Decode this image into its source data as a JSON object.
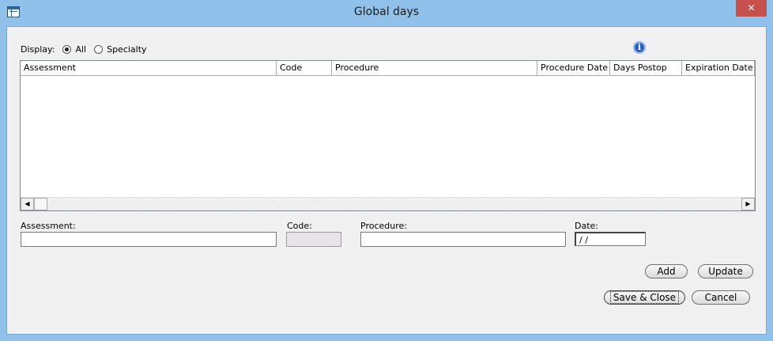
{
  "window": {
    "title": "Global days",
    "close_glyph": "✕"
  },
  "icons": {
    "app": "table-icon",
    "info": "info-icon",
    "info_glyph": "i",
    "scroll_left": "◀",
    "scroll_right": "▶"
  },
  "display": {
    "label": "Display:",
    "options": [
      {
        "label": "All",
        "selected": true
      },
      {
        "label": "Specialty",
        "selected": false
      }
    ]
  },
  "grid": {
    "columns": [
      "Assessment",
      "Code",
      "Procedure",
      "Procedure Date",
      "Days Postop",
      "Expiration Date"
    ],
    "rows": []
  },
  "form": {
    "assessment_label": "Assessment:",
    "assessment_value": "",
    "code_label": "Code:",
    "code_value": "",
    "procedure_label": "Procedure:",
    "procedure_value": "",
    "date_label": "Date:",
    "date_value": " / /"
  },
  "buttons": {
    "add": "Add",
    "update": "Update",
    "save_close": "Save & Close",
    "cancel": "Cancel"
  },
  "colors": {
    "title_bar": "#8fc1ea",
    "close": "#c7504d",
    "info": "#2a5fc9"
  }
}
